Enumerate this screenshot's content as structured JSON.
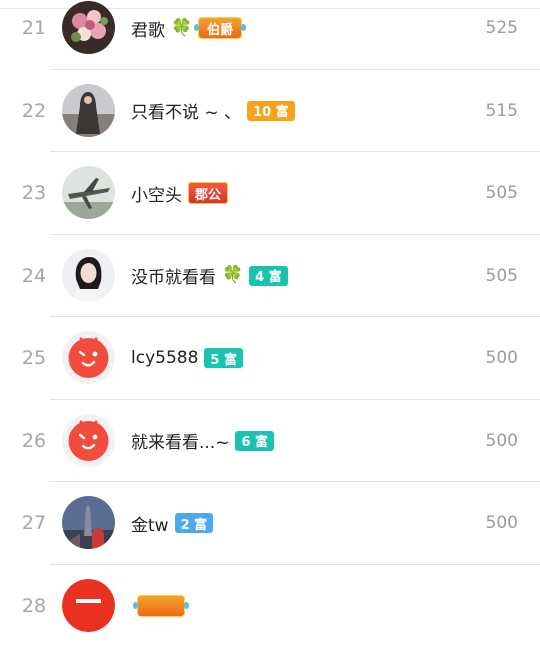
{
  "rows": [
    {
      "rank": "21",
      "name": "君歌",
      "clover": "🍀",
      "badge": "伯爵",
      "badge_type": "noble",
      "score": "525",
      "avatar": "flowers-photo"
    },
    {
      "rank": "22",
      "name": "只看不说 ~ 、",
      "badge": "10 富",
      "badge_type": "gold",
      "score": "515",
      "avatar": "hooded-figure-photo"
    },
    {
      "rank": "23",
      "name": "小空头",
      "badge": "郡公",
      "badge_type": "red",
      "score": "505",
      "avatar": "airplane-photo"
    },
    {
      "rank": "24",
      "name": "没币就看看",
      "clover": "🍀",
      "badge": "4 富",
      "badge_type": "teal",
      "score": "505",
      "avatar": "girl-portrait-photo"
    },
    {
      "rank": "25",
      "name": "lcy5588",
      "badge": "5 富",
      "badge_type": "teal",
      "score": "500",
      "avatar": "default-tv-face"
    },
    {
      "rank": "26",
      "name": "就来看看...~",
      "badge": "6 富",
      "badge_type": "teal",
      "score": "500",
      "avatar": "default-tv-face"
    },
    {
      "rank": "27",
      "name": "金tw",
      "badge": "2 富",
      "badge_type": "blue",
      "score": "500",
      "avatar": "tower-city-photo"
    },
    {
      "rank": "28",
      "name": "",
      "badge": "",
      "badge_type": "noble",
      "score": "",
      "avatar": "default-tv-face"
    }
  ],
  "colors": {
    "rank": "#a6a6a6",
    "name": "#222222",
    "score": "#9c9c9c",
    "divider": "#e3e3e3"
  }
}
